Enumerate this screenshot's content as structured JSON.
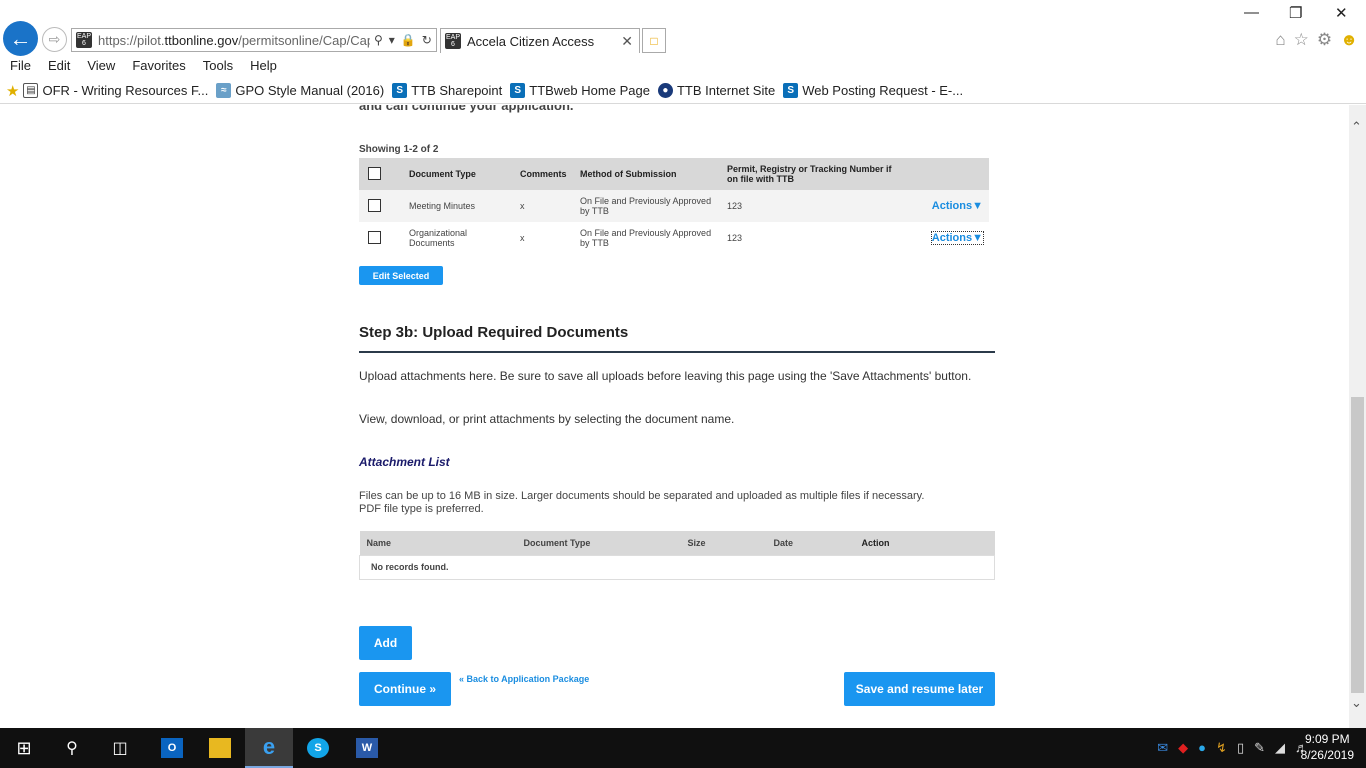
{
  "browser": {
    "url_main": "https://pilot.",
    "url_domain": "ttbonline.gov",
    "url_rest": "/permitsonline/Cap/Cap",
    "tab_title": "Accela Citizen Access",
    "eap_badge": "EAP 6"
  },
  "menu": [
    "File",
    "Edit",
    "View",
    "Favorites",
    "Tools",
    "Help"
  ],
  "favorites": [
    "OFR - Writing Resources F...",
    "GPO Style Manual (2016)",
    "TTB Sharepoint",
    "TTBweb Home Page",
    "TTB Internet Site",
    "Web Posting Request - E-..."
  ],
  "page": {
    "cut_text": "and can continue your application.",
    "showing": "Showing 1-2 of 2",
    "doc_table": {
      "headers": [
        "Document Type",
        "Comments",
        "Method of Submission",
        "Permit, Registry or Tracking Number if on file with TTB"
      ],
      "rows": [
        {
          "doc_type": "Meeting Minutes",
          "comments": "x",
          "method": "On File and Previously Approved by TTB",
          "number": "123",
          "action": "Actions"
        },
        {
          "doc_type": "Organizational Documents",
          "comments": "x",
          "method": "On File and Previously Approved by TTB",
          "number": "123",
          "action": "Actions"
        }
      ]
    },
    "edit_selected": "Edit Selected",
    "step_title": "Step 3b: Upload Required Documents",
    "para1": "Upload attachments here. Be sure to save all uploads before leaving this page using the 'Save Attachments' button.",
    "para2": "View, download, or print attachments by selecting the document name.",
    "attachment_title": "Attachment List",
    "file_note_1": "Files can be up to 16 MB in size. Larger documents should be separated and uploaded as multiple files if necessary.",
    "file_note_2": "PDF file type is preferred.",
    "attach_table": {
      "headers": [
        "Name",
        "Document Type",
        "Size",
        "Date",
        "Action"
      ],
      "empty": "No records found."
    },
    "add_label": "Add",
    "continue_label": "Continue »",
    "back_link": "« Back to Application Package",
    "save_resume": "Save and resume later"
  },
  "taskbar": {
    "time": "9:09 PM",
    "date": "8/26/2019"
  }
}
